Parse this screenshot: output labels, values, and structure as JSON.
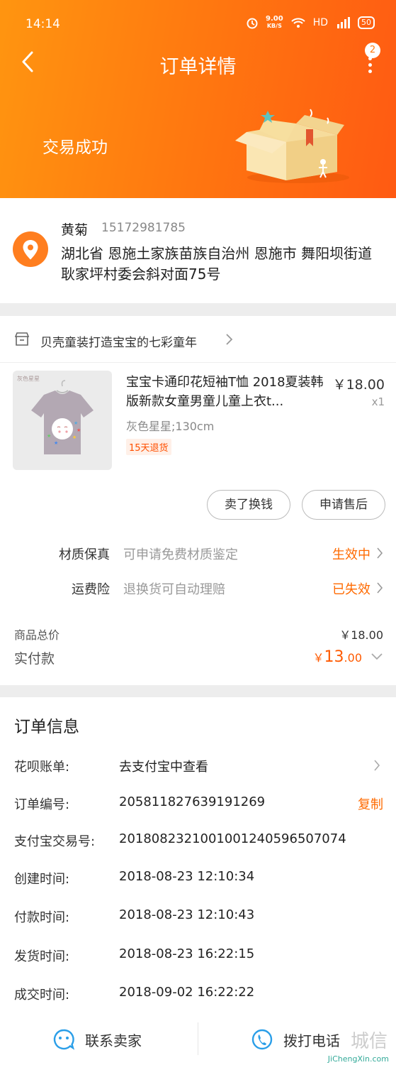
{
  "status_bar": {
    "time": "14:14",
    "net_speed": "9.00",
    "net_unit": "KB/S",
    "hd": "HD",
    "signal": "4G",
    "battery": "50"
  },
  "nav": {
    "title": "订单详情",
    "badge_count": "2"
  },
  "order_status": "交易成功",
  "address": {
    "name": "黄菊",
    "phone": "15172981785",
    "detail": "湖北省 恩施土家族苗族自治州 恩施市 舞阳坝街道 耿家坪村委会斜对面75号"
  },
  "shop": {
    "name": "贝壳童装打造宝宝的七彩童年"
  },
  "product": {
    "image_label": "灰色星星",
    "title": "宝宝卡通印花短袖T恤 2018夏装韩版新款女童男童儿童上衣t...",
    "price": "￥18.00",
    "qty": "x1",
    "spec": "灰色星星;130cm",
    "tag": "15天退货"
  },
  "actions": {
    "sell": "卖了换钱",
    "after_sale": "申请售后"
  },
  "services": [
    {
      "name": "材质保真",
      "desc": "可申请免费材质鉴定",
      "status": "生效中"
    },
    {
      "name": "运费险",
      "desc": "退换货可自动理赔",
      "status": "已失效"
    }
  ],
  "summary": {
    "total_label": "商品总价",
    "total_value": "￥18.00",
    "paid_label": "实付款",
    "paid_currency": "￥",
    "paid_int": "13",
    "paid_dec": ".00"
  },
  "order_info": {
    "title": "订单信息",
    "rows": [
      {
        "label": "花呗账单:",
        "value": "去支付宝中查看"
      },
      {
        "label": "订单编号:",
        "value": "205811827639191269",
        "action": "复制"
      },
      {
        "label": "支付宝交易号:",
        "value": "2018082321001001240596507074"
      },
      {
        "label": "创建时间:",
        "value": "2018-08-23 12:10:34"
      },
      {
        "label": "付款时间:",
        "value": "2018-08-23 12:10:43"
      },
      {
        "label": "发货时间:",
        "value": "2018-08-23 16:22:15"
      },
      {
        "label": "成交时间:",
        "value": "2018-09-02 16:22:22"
      }
    ]
  },
  "bottom": {
    "contact": "联系卖家",
    "call": "拨打电话"
  },
  "watermark": {
    "text": "JiChengXin.com",
    "big": "城信"
  },
  "colors": {
    "brand": "#ff7a10",
    "accent": "#ff6a00"
  }
}
